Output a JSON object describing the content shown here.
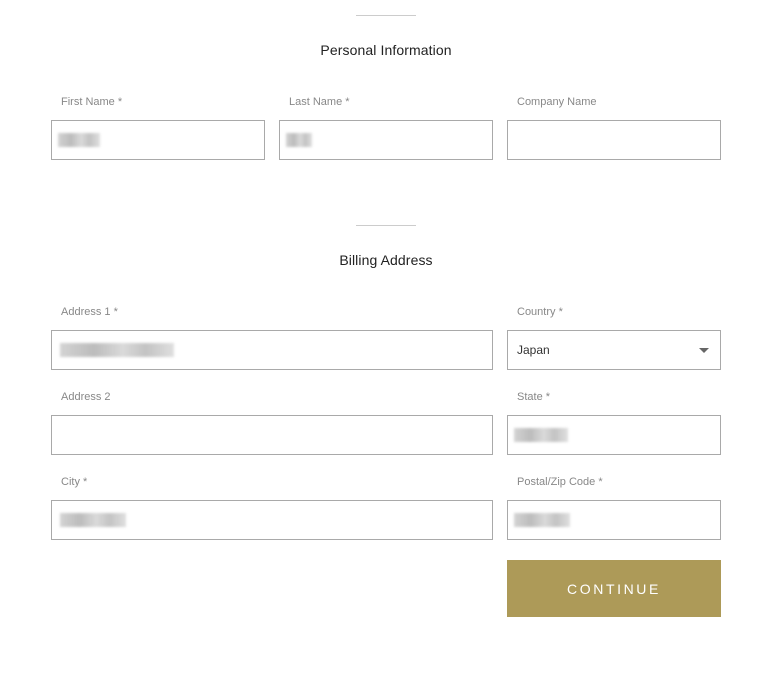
{
  "personal_section": {
    "title": "Personal Information",
    "fields": {
      "first_name": {
        "label": "First Name *",
        "value_redacted": true
      },
      "last_name": {
        "label": "Last Name *",
        "value_redacted": true
      },
      "company_name": {
        "label": "Company Name",
        "value": ""
      }
    }
  },
  "billing_section": {
    "title": "Billing Address",
    "fields": {
      "address1": {
        "label": "Address 1 *",
        "value_redacted": true
      },
      "country": {
        "label": "Country *",
        "selected": "Japan"
      },
      "address2": {
        "label": "Address 2",
        "value": ""
      },
      "state": {
        "label": "State *",
        "value_redacted": true
      },
      "city": {
        "label": "City *",
        "value_redacted": true
      },
      "postal": {
        "label": "Postal/Zip Code *",
        "value_redacted": true
      }
    }
  },
  "actions": {
    "continue_label": "CONTINUE"
  },
  "colors": {
    "accent": "#ad9a58",
    "input_border": "#a9a9a9",
    "label": "#888888",
    "divider": "#cccccc"
  },
  "icons": {
    "country_dropdown": "caret-down-icon"
  }
}
